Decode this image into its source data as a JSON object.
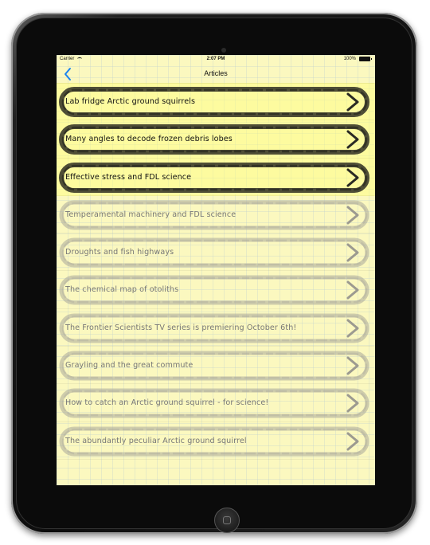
{
  "status": {
    "carrier": "Carrier",
    "time": "2:07 PM",
    "battery": "100%"
  },
  "nav": {
    "title": "Articles"
  },
  "articles": [
    {
      "title": "Lab fridge Arctic ground squirrels",
      "active": true
    },
    {
      "title": "Many angles to decode frozen debris lobes",
      "active": true
    },
    {
      "title": "Effective stress and FDL science",
      "active": true
    },
    {
      "title": "Temperamental machinery and FDL science",
      "active": false
    },
    {
      "title": "Droughts and fish highways",
      "active": false
    },
    {
      "title": "The chemical map of otoliths",
      "active": false
    },
    {
      "title": "The Frontier Scientists TV series is premiering October 6th!",
      "active": false
    },
    {
      "title": "Grayling and the great commute",
      "active": false
    },
    {
      "title": "How to catch an Arctic ground squirrel - for science!",
      "active": false
    },
    {
      "title": "The abundantly peculiar Arctic ground squirrel",
      "active": false
    }
  ],
  "colors": {
    "accent": "#1a84f0",
    "paper": "#fbf8bf",
    "active_ring": "#1e1e18",
    "inactive_ring": "#a9a79a"
  }
}
